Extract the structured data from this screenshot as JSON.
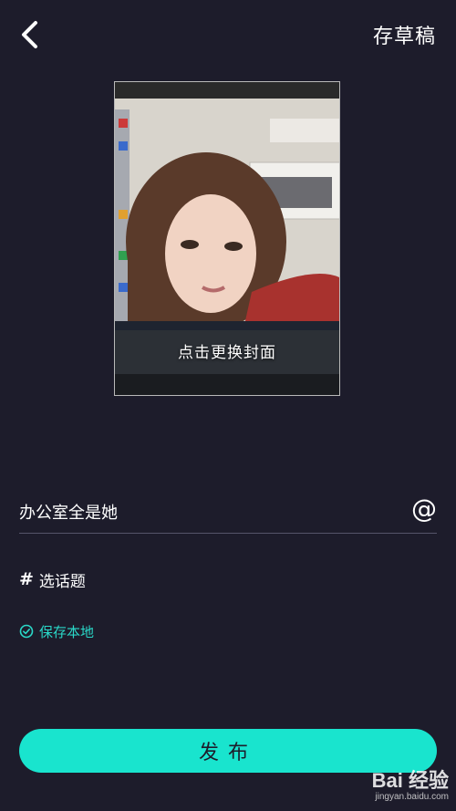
{
  "header": {
    "back_icon": "chevron-left-icon",
    "draft_label": "存草稿"
  },
  "cover": {
    "change_label": "点击更换封面"
  },
  "form": {
    "title_value": "办公室全是她",
    "mention_symbol": "@",
    "topic_symbol": "#",
    "topic_label": "选话题",
    "save_local_label": "保存本地",
    "save_local_icon": "check-circle-icon"
  },
  "footer": {
    "publish_label": "发布"
  },
  "watermark": {
    "brand": "Bai 经验",
    "url": "jingyan.baidu.com"
  },
  "colors": {
    "background": "#1d1c2b",
    "accent": "#19e4ce",
    "accent_text": "#2ad8c8"
  }
}
